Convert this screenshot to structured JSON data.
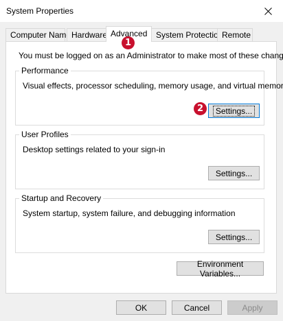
{
  "window": {
    "title": "System Properties"
  },
  "tabs": [
    {
      "label": "Computer Name"
    },
    {
      "label": "Hardware"
    },
    {
      "label": "Advanced"
    },
    {
      "label": "System Protection"
    },
    {
      "label": "Remote"
    }
  ],
  "active_tab": "Advanced",
  "advanced": {
    "admin_notice": "You must be logged on as an Administrator to make most of these changes.",
    "performance": {
      "title": "Performance",
      "description": "Visual effects, processor scheduling, memory usage, and virtual memory",
      "settings_label": "Settings..."
    },
    "user_profiles": {
      "title": "User Profiles",
      "description": "Desktop settings related to your sign-in",
      "settings_label": "Settings..."
    },
    "startup_recovery": {
      "title": "Startup and Recovery",
      "description": "System startup, system failure, and debugging information",
      "settings_label": "Settings..."
    },
    "env_vars_label": "Environment Variables..."
  },
  "footer": {
    "ok_label": "OK",
    "cancel_label": "Cancel",
    "apply_label": "Apply"
  },
  "annotations": {
    "badge_1": "1",
    "badge_2": "2"
  },
  "colors": {
    "badge": "#c8102e",
    "focus_border": "#0078d7"
  },
  "icons": {
    "close": "close-icon"
  }
}
